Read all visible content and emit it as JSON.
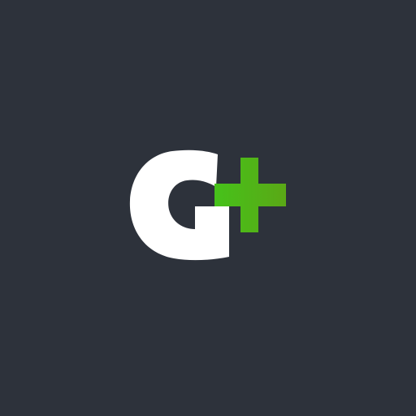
{
  "page": {
    "background_color": "#2d323b"
  },
  "logo": {
    "icon": "g-plus-logo-icon",
    "letter_color": "#ffffff",
    "plus_color_start": "#46c21a",
    "plus_color_end": "#5aa816"
  }
}
